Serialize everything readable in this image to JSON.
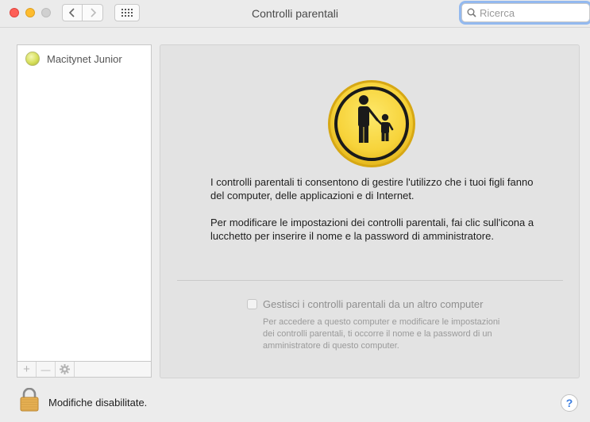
{
  "window": {
    "title": "Controlli parentali"
  },
  "search": {
    "placeholder": "Ricerca"
  },
  "users": [
    {
      "name": "Macitynet Junior"
    }
  ],
  "panel": {
    "description_1": "I controlli parentali ti consentono di gestire l'utilizzo che i tuoi figli fanno del computer, delle applicazioni e di Internet.",
    "description_2": "Per modificare le impostazioni dei controlli parentali, fai clic sull'icona a lucchetto per inserire il nome e la password di amministratore.",
    "remote_checkbox_label": "Gestisci i controlli parentali da un altro computer",
    "remote_checkbox_checked": false,
    "remote_help": "Per accedere a questo computer e modificare le impostazioni dei controlli parentali, ti occorre il nome e la password di un amministratore di questo computer."
  },
  "footer": {
    "lock_status": "Modifiche disabilitate.",
    "help_label": "?"
  },
  "list_controls": {
    "add": "+",
    "remove": "—"
  },
  "icons": {
    "back": "chevron-left-icon",
    "forward": "chevron-right-icon",
    "grid": "grid-icon",
    "search": "magnifier-icon",
    "gear": "gear-icon",
    "lock": "padlock-icon",
    "parental": "parent-child-icon"
  },
  "colors": {
    "icon_yellow": "#f7d33a",
    "focus_ring": "#93b9ef",
    "help_blue": "#3b7de0"
  }
}
